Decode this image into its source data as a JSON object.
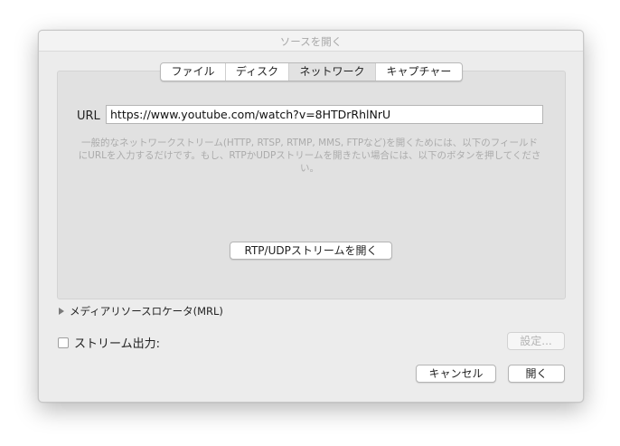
{
  "window": {
    "title": "ソースを開く"
  },
  "tabs": [
    {
      "label": "ファイル",
      "active": false
    },
    {
      "label": "ディスク",
      "active": false
    },
    {
      "label": "ネットワーク",
      "active": true
    },
    {
      "label": "キャプチャー",
      "active": false
    }
  ],
  "network": {
    "url_label": "URL",
    "url_value": "https://www.youtube.com/watch?v=8HTDrRhlNrU",
    "help_text": "一般的なネットワークストリーム(HTTP, RTSP, RTMP, MMS, FTPなど)を開くためには、以下のフィールドにURLを入力するだけです。もし、RTPかUDPストリームを開きたい場合には、以下のボタンを押してください。",
    "rtp_button": "RTP/UDPストリームを開く"
  },
  "mrl": {
    "label": "メディアリソースロケータ(MRL)",
    "expanded": false
  },
  "stream_output": {
    "label": "ストリーム出力:",
    "checked": false,
    "settings_button": "設定..."
  },
  "footer": {
    "cancel_button": "キャンセル",
    "open_button": "開く"
  },
  "colors": {
    "window_bg": "#ececec",
    "panel_bg": "#e1e1e1",
    "title_text": "#a8a8a8",
    "help_text": "#ababab",
    "active_tab": "#e2e2e2"
  }
}
